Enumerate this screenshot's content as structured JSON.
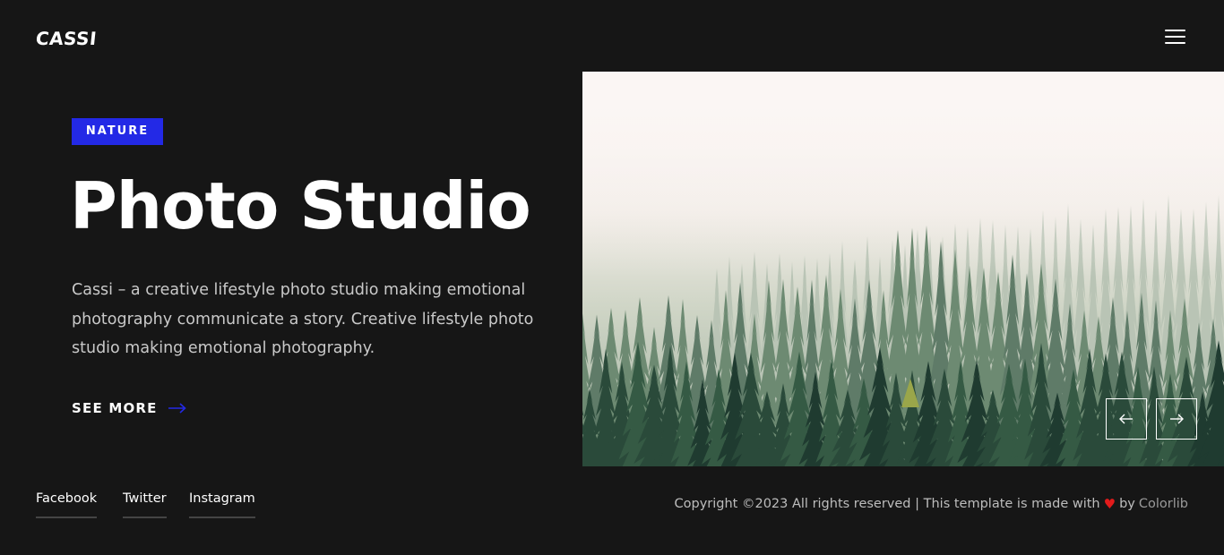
{
  "header": {
    "logo": "CASSI",
    "menu_icon": "hamburger-menu-icon"
  },
  "hero": {
    "badge": "NATURE",
    "title": "Photo Studio",
    "description": "Cassi – a creative lifestyle photo studio making emotional photography communicate a story. Creative lifestyle photo studio making emotional photography.",
    "cta_label": "SEE MORE",
    "cta_icon": "arrow-right-icon",
    "accent_color": "#2329e6"
  },
  "slider": {
    "image": "misty-forest-image",
    "prev_icon": "arrow-left-icon",
    "next_icon": "arrow-right-icon"
  },
  "footer": {
    "social": [
      {
        "label": "Facebook"
      },
      {
        "label": "Twitter"
      },
      {
        "label": "Instagram"
      }
    ],
    "copyright_text": "Copyright ©2023 All rights reserved | This template is made with",
    "heart": "♥",
    "by_text": "by",
    "credit_link": "Colorlib"
  }
}
